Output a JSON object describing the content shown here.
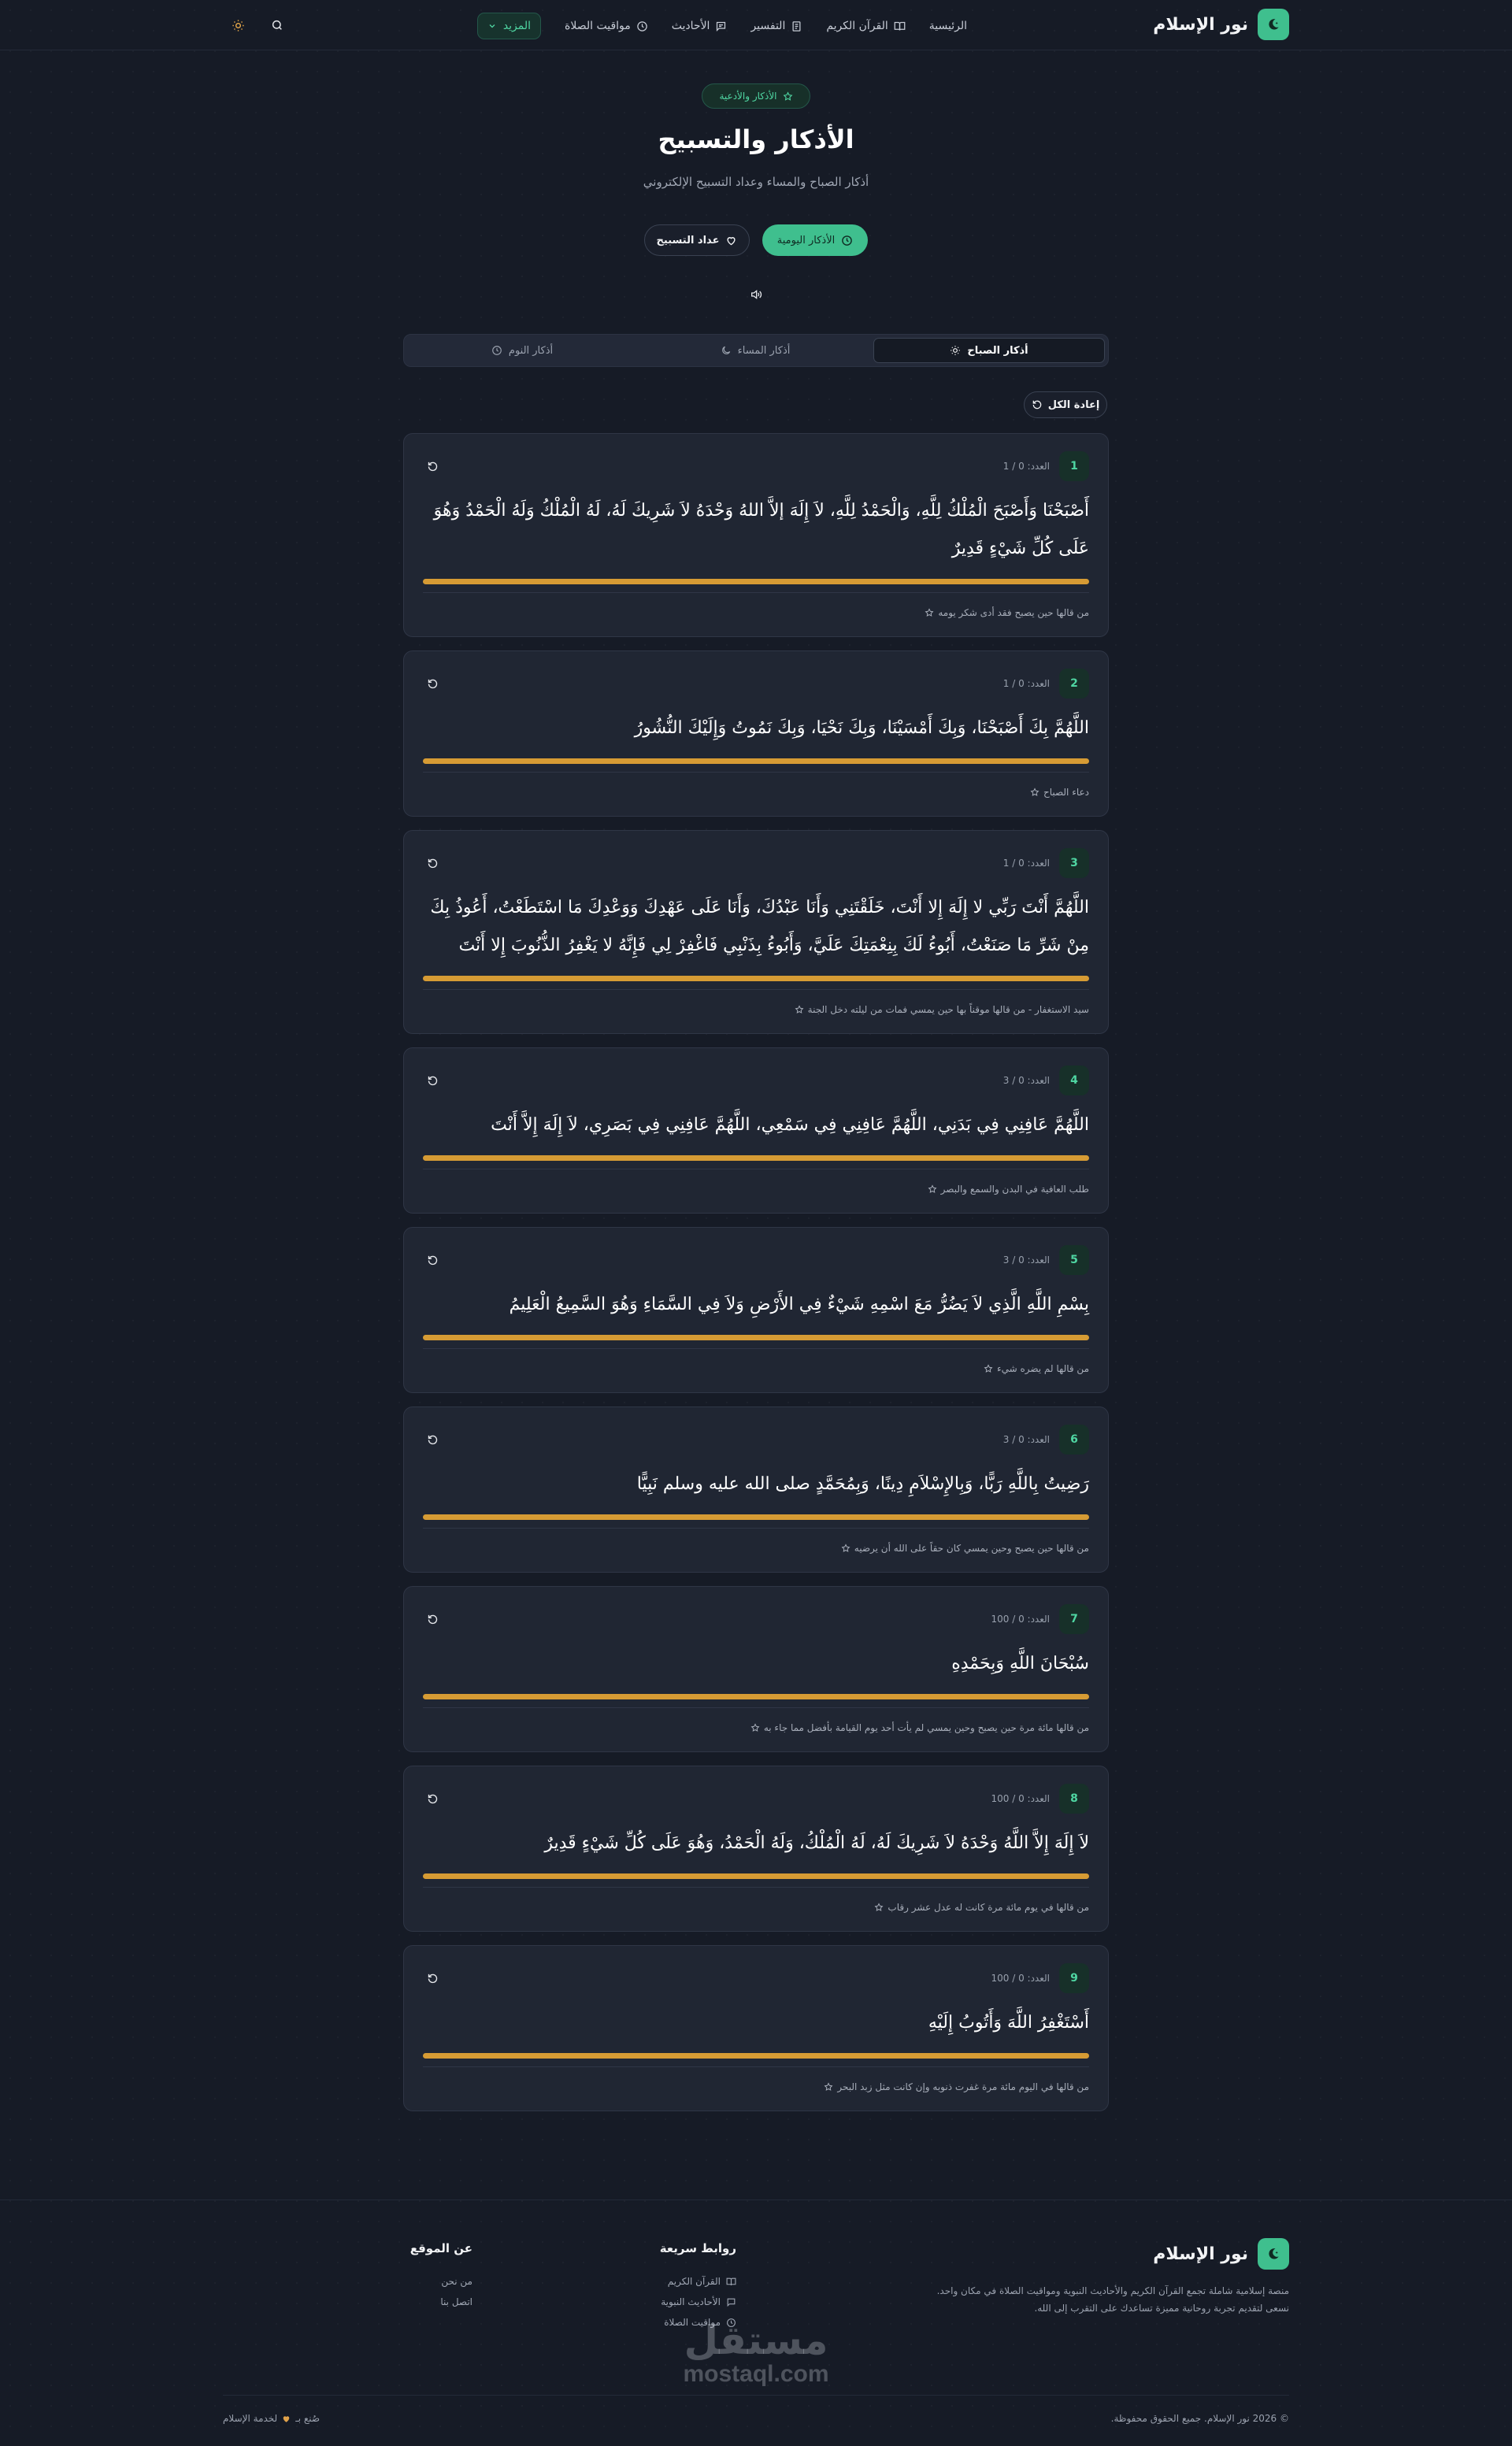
{
  "header": {
    "brand": "نور الإسلام",
    "nav": [
      {
        "label": "الرئيسية",
        "icon": ""
      },
      {
        "label": "القرآن الكريم",
        "icon": "book-open-icon"
      },
      {
        "label": "التفسير",
        "icon": "book-icon"
      },
      {
        "label": "الأحاديث",
        "icon": "message-icon"
      },
      {
        "label": "مواقيت الصلاة",
        "icon": "clock-icon"
      }
    ],
    "more_label": "المزيد"
  },
  "hero": {
    "badge": "الأذكار والأدعية",
    "title": "الأذكار والتسبيح",
    "subtitle": "أذكار الصباح والمساء وعداد التسبيح الإلكتروني",
    "primary_button": "الأذكار اليومية",
    "secondary_button": "عداد التسبيح"
  },
  "tabs": [
    {
      "label": "أذكار الصباح",
      "active": true
    },
    {
      "label": "أذكار المساء",
      "active": false
    },
    {
      "label": "أذكار النوم",
      "active": false
    }
  ],
  "reset_all": "إعادة الكل",
  "count_prefix": "العدد:",
  "cards": [
    {
      "num": "1",
      "count": "0 / 1",
      "text": "أَصْبَحْنَا وَأَصْبَحَ الْمُلْكُ لِلَّهِ، وَالْحَمْدُ لِلَّهِ، لاَ إِلَهَ إلاَّ اللهُ وَحْدَهُ لاَ شَرِيكَ لَهُ، لَهُ الْمُلْكُ وَلَهُ الْحَمْدُ وَهُوَ عَلَى كُلِّ شَيْءٍ قَدِيرٌ",
      "note": "من قالها حين يصبح فقد أدى شكر يومه"
    },
    {
      "num": "2",
      "count": "0 / 1",
      "text": "اللَّهُمَّ بِكَ أَصْبَحْنَا، وَبِكَ أَمْسَيْنَا، وَبِكَ نَحْيَا، وَبِكَ نَمُوتُ وَإِلَيْكَ النُّشُورُ",
      "note": "دعاء الصباح"
    },
    {
      "num": "3",
      "count": "0 / 1",
      "text": "اللَّهُمَّ أَنْتَ رَبِّي لا إِلَهَ إِلا أَنْتَ، خَلَقْتَنِي وَأَنَا عَبْدُكَ، وَأَنَا عَلَى عَهْدِكَ وَوَعْدِكَ مَا اسْتَطَعْتُ، أَعُوذُ بِكَ مِنْ شَرِّ مَا صَنَعْتُ، أَبُوءُ لَكَ بِنِعْمَتِكَ عَلَيَّ، وَأَبُوءُ بِذَنْبِي فَاغْفِرْ لِي فَإِنَّهُ لا يَغْفِرُ الذُّنُوبَ إِلا أَنْتَ",
      "note": "سيد الاستغفار - من قالها موقناً بها حين يمسي فمات من ليلته دخل الجنة"
    },
    {
      "num": "4",
      "count": "0 / 3",
      "text": "اللَّهُمَّ عَافِنِي فِي بَدَنِي، اللَّهُمَّ عَافِنِي فِي سَمْعِي، اللَّهُمَّ عَافِنِي فِي بَصَرِي، لاَ إِلَهَ إِلاَّ أَنْتَ",
      "note": "طلب العافية في البدن والسمع والبصر"
    },
    {
      "num": "5",
      "count": "0 / 3",
      "text": "بِسْمِ اللَّهِ الَّذِي لاَ يَضُرُّ مَعَ اسْمِهِ شَيْءٌ فِي الأَرْضِ وَلاَ فِي السَّمَاءِ وَهُوَ السَّمِيعُ الْعَلِيمُ",
      "note": "من قالها لم يضره شيء"
    },
    {
      "num": "6",
      "count": "0 / 3",
      "text": "رَضِيتُ بِاللَّهِ رَبًّا، وَبِالإِسْلاَمِ دِينًا، وَبِمُحَمَّدٍ صلى الله عليه وسلم نَبِيًّا",
      "note": "من قالها حين يصبح وحين يمسي كان حقاً على الله أن يرضيه"
    },
    {
      "num": "7",
      "count": "0 / 100",
      "text": "سُبْحَانَ اللَّهِ وَبِحَمْدِهِ",
      "note": "من قالها مائة مرة حين يصبح وحين يمسي لم يأت أحد يوم القيامة بأفضل مما جاء به"
    },
    {
      "num": "8",
      "count": "0 / 100",
      "text": "لاَ إِلَهَ إِلاَّ اللَّهُ وَحْدَهُ لاَ شَرِيكَ لَهُ، لَهُ الْمُلْكُ، وَلَهُ الْحَمْدُ، وَهُوَ عَلَى كُلِّ شَيْءٍ قَدِيرٌ",
      "note": "من قالها في يوم مائة مرة كانت له عدل عشر رقاب"
    },
    {
      "num": "9",
      "count": "0 / 100",
      "text": "أَسْتَغْفِرُ اللَّهَ وَأَتُوبُ إِلَيْهِ",
      "note": "من قالها في اليوم مائة مرة غفرت ذنوبه وإن كانت مثل زبد البحر"
    }
  ],
  "footer": {
    "brand": "نور الإسلام",
    "description": "منصة إسلامية شاملة تجمع القرآن الكريم والأحاديث النبوية ومواقيت الصلاة في مكان واحد. نسعى لتقديم تجربة روحانية مميزة تساعدك على التقرب إلى الله.",
    "quick_links_title": "روابط سريعة",
    "quick_links": [
      {
        "label": "القرآن الكريم",
        "icon": "book-open-icon"
      },
      {
        "label": "الأحاديث النبوية",
        "icon": "message-icon"
      },
      {
        "label": "مواقيت الصلاة",
        "icon": "clock-icon"
      }
    ],
    "about_title": "عن الموقع",
    "about_links": [
      "من نحن",
      "اتصل بنا"
    ],
    "copyright": "© 2026 نور الإسلام. جميع الحقوق محفوظة.",
    "made_with_prefix": "صُنع بـ",
    "made_with_suffix": "لخدمة الإسلام"
  },
  "watermark": {
    "arabic": "مستقل",
    "latin": "mostaql.com"
  },
  "colors": {
    "accent": "#3fbf8e",
    "progress": "#d69b34",
    "background": "#161b26",
    "card": "#202633"
  }
}
